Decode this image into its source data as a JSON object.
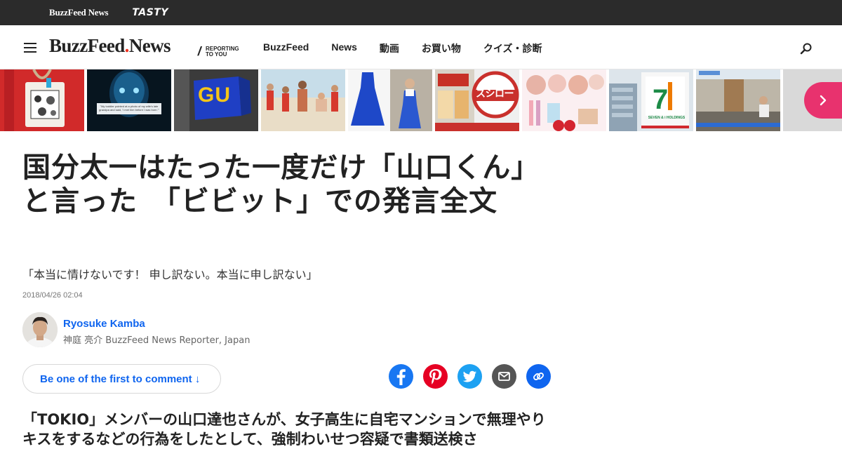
{
  "brandbar": {
    "buzzfeed_news": "BuzzFeed News",
    "tasty": "TASTY"
  },
  "nav": {
    "logo": "BuzzFeed",
    "logo_news": "News",
    "tagline_line1": "REPORTING",
    "tagline_line2": "TO YOU",
    "links": [
      "BuzzFeed",
      "News",
      "動画",
      "お買い物",
      "クイズ・診断"
    ]
  },
  "trending": {
    "thumb2_caption": "\"My toddler pointed at a photo of my wife's late grandpa and said, 'I met him before I was born.'\"",
    "thumb3_sign": "GU",
    "thumb6_sign": "スシロー",
    "thumb8_sign": "SEVEN & i HOLDINGS"
  },
  "article": {
    "title": "国分太一はたった一度だけ「山口くん」と言った　「ビビット」での発言全文",
    "subtitle": "「本当に情けないです！ 申し訳ない。本当に申し訳ない」",
    "date": "2018/04/26 02:04",
    "author_name": "Ryosuke Kamba",
    "author_title": "神庭 亮介 BuzzFeed News Reporter, Japan",
    "comment_label": "Be one of the first to comment ↓",
    "lead": "「TOKIO」メンバーの山口達也さんが、女子高生に自宅マンションで無理やりキスをするなどの行為をしたとして、強制わいせつ容疑で書類送検さ"
  },
  "colors": {
    "accent_blue": "#0f65ef",
    "facebook": "#1877f2",
    "pinterest": "#e60023",
    "twitter": "#1da1f2",
    "email": "#555555",
    "link": "#0f65ef",
    "next_button": "#e8326e"
  }
}
